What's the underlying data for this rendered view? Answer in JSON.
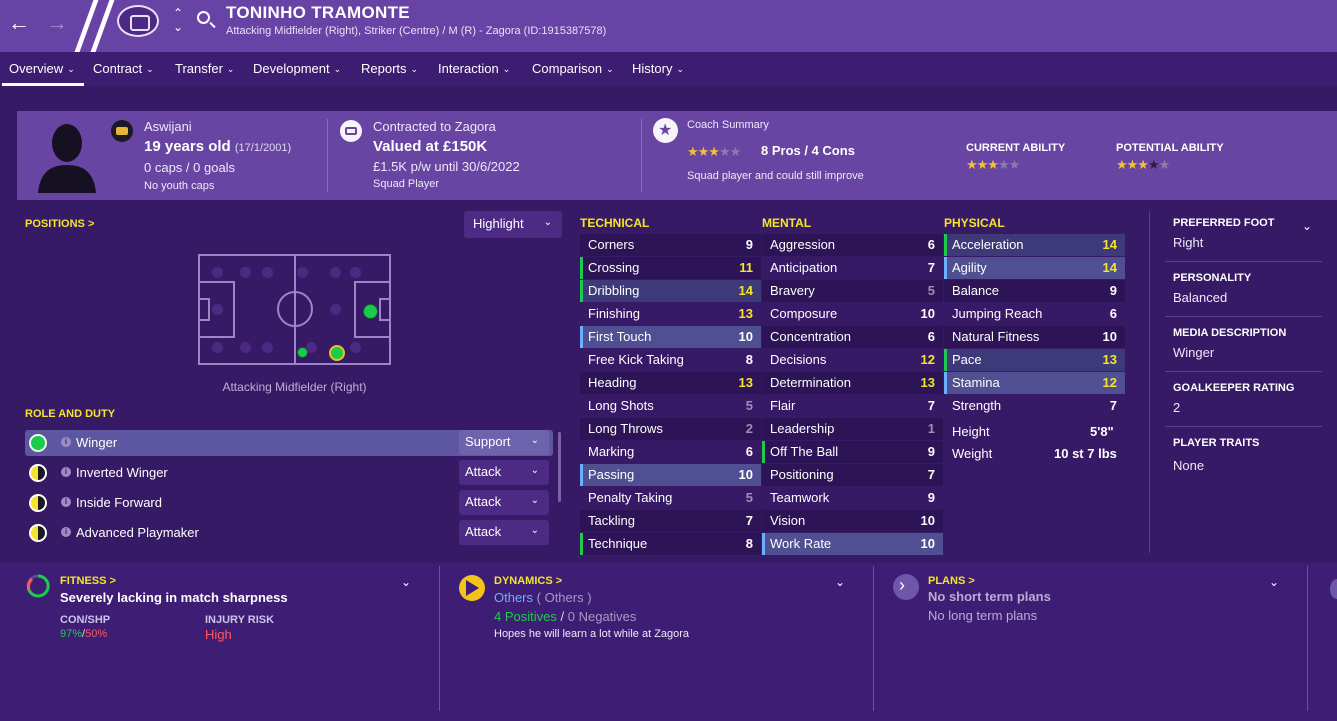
{
  "header": {
    "back_icon": "arrow-left-icon",
    "forward_icon": "arrow-right-icon",
    "name": "TONINHO TRAMONTE",
    "subtitle": "Attacking Midfielder (Right), Striker (Centre) / M (R) - Zagora (ID:1915387578)"
  },
  "tabs": [
    {
      "label": "Overview"
    },
    {
      "label": "Contract"
    },
    {
      "label": "Transfer"
    },
    {
      "label": "Development"
    },
    {
      "label": "Reports"
    },
    {
      "label": "Interaction"
    },
    {
      "label": "Comparison"
    },
    {
      "label": "History"
    }
  ],
  "summary": {
    "nation": "Aswijani",
    "age": "19 years old",
    "dob": "(17/1/2001)",
    "caps": "0 caps / 0 goals",
    "youth_caps": "No youth caps",
    "contract_to": "Contracted to Zagora",
    "value": "Valued at £150K",
    "wage": "£1.5K p/w until 30/6/2022",
    "squad_status": "Squad Player",
    "coach_title": "Coach Summary",
    "coach_rating": 3,
    "pros_cons": "8 Pros / 4 Cons",
    "coach_note": "Squad player and could still improve",
    "current_ability_label": "CURRENT ABILITY",
    "current_ability": 3,
    "potential_ability_label": "POTENTIAL ABILITY",
    "potential_ability": 3.5
  },
  "positions": {
    "title": "POSITIONS >",
    "highlight": "Highlight",
    "caption": "Attacking Midfielder (Right)"
  },
  "roles": {
    "title": "ROLE AND DUTY",
    "items": [
      {
        "name": "Winger",
        "duty": "Support"
      },
      {
        "name": "Inverted Winger",
        "duty": "Attack"
      },
      {
        "name": "Inside Forward",
        "duty": "Attack"
      },
      {
        "name": "Advanced Playmaker",
        "duty": "Attack"
      }
    ]
  },
  "attributes": {
    "technical_label": "TECHNICAL",
    "mental_label": "MENTAL",
    "physical_label": "PHYSICAL",
    "technical": [
      {
        "name": "Corners",
        "value": "9"
      },
      {
        "name": "Crossing",
        "value": "11"
      },
      {
        "name": "Dribbling",
        "value": "14"
      },
      {
        "name": "Finishing",
        "value": "13"
      },
      {
        "name": "First Touch",
        "value": "10"
      },
      {
        "name": "Free Kick Taking",
        "value": "8"
      },
      {
        "name": "Heading",
        "value": "13"
      },
      {
        "name": "Long Shots",
        "value": "5"
      },
      {
        "name": "Long Throws",
        "value": "2"
      },
      {
        "name": "Marking",
        "value": "6"
      },
      {
        "name": "Passing",
        "value": "10"
      },
      {
        "name": "Penalty Taking",
        "value": "5"
      },
      {
        "name": "Tackling",
        "value": "7"
      },
      {
        "name": "Technique",
        "value": "8"
      }
    ],
    "mental": [
      {
        "name": "Aggression",
        "value": "6"
      },
      {
        "name": "Anticipation",
        "value": "7"
      },
      {
        "name": "Bravery",
        "value": "5"
      },
      {
        "name": "Composure",
        "value": "10"
      },
      {
        "name": "Concentration",
        "value": "6"
      },
      {
        "name": "Decisions",
        "value": "12"
      },
      {
        "name": "Determination",
        "value": "13"
      },
      {
        "name": "Flair",
        "value": "7"
      },
      {
        "name": "Leadership",
        "value": "1"
      },
      {
        "name": "Off The Ball",
        "value": "9"
      },
      {
        "name": "Positioning",
        "value": "7"
      },
      {
        "name": "Teamwork",
        "value": "9"
      },
      {
        "name": "Vision",
        "value": "10"
      },
      {
        "name": "Work Rate",
        "value": "10"
      }
    ],
    "physical": [
      {
        "name": "Acceleration",
        "value": "14"
      },
      {
        "name": "Agility",
        "value": "14"
      },
      {
        "name": "Balance",
        "value": "9"
      },
      {
        "name": "Jumping Reach",
        "value": "6"
      },
      {
        "name": "Natural Fitness",
        "value": "10"
      },
      {
        "name": "Pace",
        "value": "13"
      },
      {
        "name": "Stamina",
        "value": "12"
      },
      {
        "name": "Strength",
        "value": "7"
      }
    ],
    "height_label": "Height",
    "height": "5'8\"",
    "weight_label": "Weight",
    "weight": "10 st 7 lbs"
  },
  "info": {
    "foot_label": "PREFERRED FOOT",
    "foot": "Right",
    "personality_label": "PERSONALITY",
    "personality": "Balanced",
    "media_label": "MEDIA DESCRIPTION",
    "media": "Winger",
    "gk_label": "GOALKEEPER RATING",
    "gk": "2",
    "traits_label": "PLAYER TRAITS",
    "traits": "None"
  },
  "fitness": {
    "title": "FITNESS >",
    "status": "Severely lacking in match sharpness",
    "con_shp_label": "CON/SHP",
    "con": "97%",
    "sep": "/",
    "shp": "50%",
    "injury_label": "INJURY RISK",
    "injury": "High"
  },
  "dynamics": {
    "title": "DYNAMICS >",
    "group": "Others",
    "group_paren": "( Others )",
    "positives": "4 Positives",
    "sep": "/",
    "negatives": "0 Negatives",
    "note": "Hopes he will learn a lot while at Zagora"
  },
  "plans": {
    "title": "PLANS >",
    "short": "No short term plans",
    "long": "No long term plans"
  },
  "colors": {
    "accent_yellow": "#f5e52a",
    "good_green": "#1ccb4c",
    "bad_red": "#ff5a5a",
    "header_purple": "#6843a6"
  }
}
